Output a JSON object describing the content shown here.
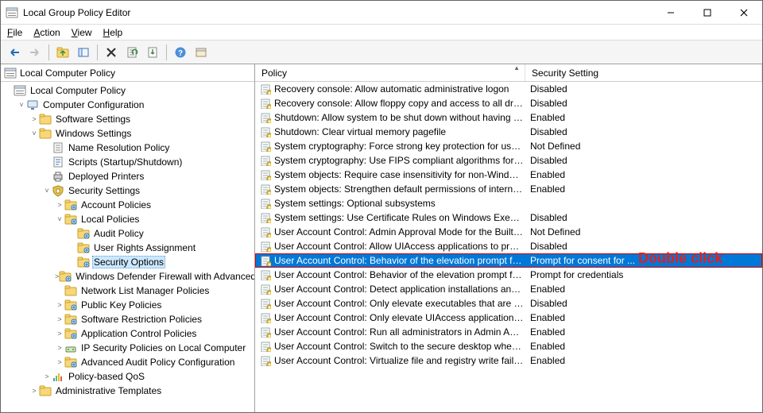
{
  "window": {
    "title": "Local Group Policy Editor"
  },
  "menu": {
    "file": "File",
    "action": "Action",
    "view": "View",
    "help": "Help"
  },
  "tree_header": "Local Computer Policy",
  "tree": [
    {
      "indent": 1,
      "expand": "",
      "icon": "root",
      "label": "Local Computer Policy",
      "selected": false
    },
    {
      "indent": 2,
      "expand": "open",
      "icon": "computer",
      "label": "Computer Configuration"
    },
    {
      "indent": 3,
      "expand": "closed",
      "icon": "folder",
      "label": "Software Settings"
    },
    {
      "indent": 3,
      "expand": "open",
      "icon": "folder",
      "label": "Windows Settings"
    },
    {
      "indent": 4,
      "expand": "",
      "icon": "doc",
      "label": "Name Resolution Policy"
    },
    {
      "indent": 4,
      "expand": "",
      "icon": "script",
      "label": "Scripts (Startup/Shutdown)"
    },
    {
      "indent": 4,
      "expand": "",
      "icon": "printer",
      "label": "Deployed Printers"
    },
    {
      "indent": 4,
      "expand": "open",
      "icon": "security",
      "label": "Security Settings"
    },
    {
      "indent": 5,
      "expand": "closed",
      "icon": "folder-s",
      "label": "Account Policies"
    },
    {
      "indent": 5,
      "expand": "open",
      "icon": "folder-s",
      "label": "Local Policies"
    },
    {
      "indent": 6,
      "expand": "",
      "icon": "folder-s",
      "label": "Audit Policy"
    },
    {
      "indent": 6,
      "expand": "",
      "icon": "folder-s",
      "label": "User Rights Assignment"
    },
    {
      "indent": 6,
      "expand": "",
      "icon": "folder-s",
      "label": "Security Options",
      "selected": true
    },
    {
      "indent": 5,
      "expand": "closed",
      "icon": "folder-s",
      "label": "Windows Defender Firewall with Advanced Security"
    },
    {
      "indent": 5,
      "expand": "",
      "icon": "folder",
      "label": "Network List Manager Policies"
    },
    {
      "indent": 5,
      "expand": "closed",
      "icon": "folder-s",
      "label": "Public Key Policies"
    },
    {
      "indent": 5,
      "expand": "closed",
      "icon": "folder-s",
      "label": "Software Restriction Policies"
    },
    {
      "indent": 5,
      "expand": "closed",
      "icon": "folder-s",
      "label": "Application Control Policies"
    },
    {
      "indent": 5,
      "expand": "closed",
      "icon": "ipsec",
      "label": "IP Security Policies on Local Computer"
    },
    {
      "indent": 5,
      "expand": "closed",
      "icon": "folder-s",
      "label": "Advanced Audit Policy Configuration"
    },
    {
      "indent": 4,
      "expand": "closed",
      "icon": "qos",
      "label": "Policy-based QoS"
    },
    {
      "indent": 3,
      "expand": "closed",
      "icon": "folder",
      "label": "Administrative Templates"
    }
  ],
  "columns": {
    "policy": "Policy",
    "setting": "Security Setting"
  },
  "rows": [
    {
      "name": "Recovery console: Allow automatic administrative logon",
      "value": "Disabled"
    },
    {
      "name": "Recovery console: Allow floppy copy and access to all drives...",
      "value": "Disabled"
    },
    {
      "name": "Shutdown: Allow system to be shut down without having to...",
      "value": "Enabled"
    },
    {
      "name": "Shutdown: Clear virtual memory pagefile",
      "value": "Disabled"
    },
    {
      "name": "System cryptography: Force strong key protection for user k...",
      "value": "Not Defined"
    },
    {
      "name": "System cryptography: Use FIPS compliant algorithms for en...",
      "value": "Disabled"
    },
    {
      "name": "System objects: Require case insensitivity for non-Windows ...",
      "value": "Enabled"
    },
    {
      "name": "System objects: Strengthen default permissions of internal s...",
      "value": "Enabled"
    },
    {
      "name": "System settings: Optional subsystems",
      "value": ""
    },
    {
      "name": "System settings: Use Certificate Rules on Windows Executabl...",
      "value": "Disabled"
    },
    {
      "name": "User Account Control: Admin Approval Mode for the Built-i...",
      "value": "Not Defined"
    },
    {
      "name": "User Account Control: Allow UIAccess applications to prom...",
      "value": "Disabled"
    },
    {
      "name": "User Account Control: Behavior of the elevation prompt for ...",
      "value": "Prompt for consent for ...",
      "selected": true
    },
    {
      "name": "User Account Control: Behavior of the elevation prompt for ...",
      "value": "Prompt for credentials"
    },
    {
      "name": "User Account Control: Detect application installations and p...",
      "value": "Enabled"
    },
    {
      "name": "User Account Control: Only elevate executables that are sign...",
      "value": "Disabled"
    },
    {
      "name": "User Account Control: Only elevate UIAccess applications th...",
      "value": "Enabled"
    },
    {
      "name": "User Account Control: Run all administrators in Admin Appr...",
      "value": "Enabled"
    },
    {
      "name": "User Account Control: Switch to the secure desktop when pr...",
      "value": "Enabled"
    },
    {
      "name": "User Account Control: Virtualize file and registry write failure...",
      "value": "Enabled"
    }
  ],
  "annotation": "Double click"
}
